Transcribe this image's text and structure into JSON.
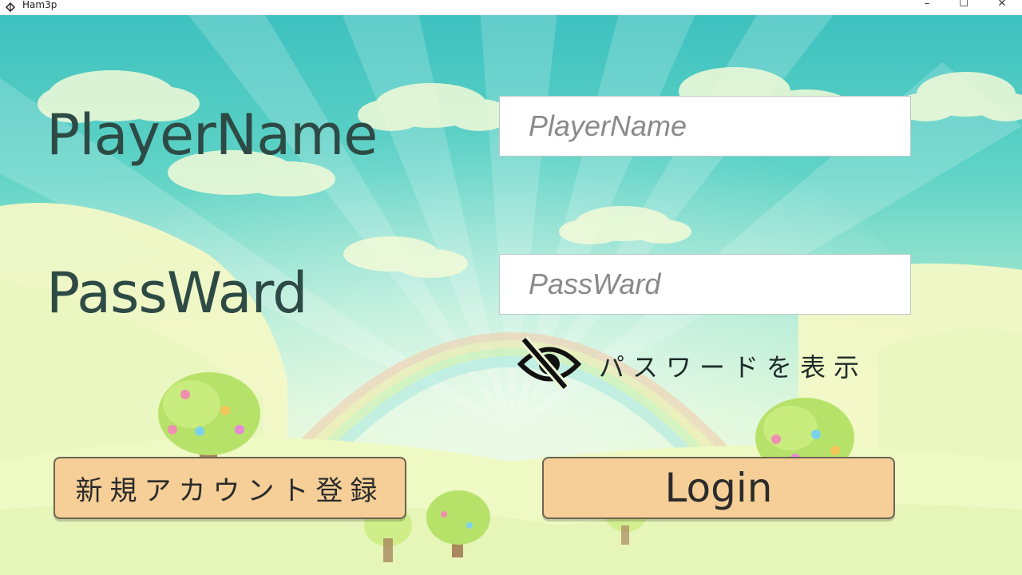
{
  "window": {
    "title": "Ham3p",
    "minimize_glyph": "–",
    "maximize_glyph": "☐",
    "close_glyph": "✕"
  },
  "form": {
    "player_name_label": "PlayerName",
    "player_name_placeholder": "PlayerName",
    "player_name_value": "",
    "password_label": "PassWard",
    "password_placeholder": "PassWard",
    "password_value": "",
    "show_password_label": "パスワードを表示",
    "show_password_icon": "eye-slash-icon"
  },
  "buttons": {
    "register_label": "新規アカウント登録",
    "login_label": "Login"
  },
  "colors": {
    "button_fill": "#f5cf97",
    "label_text": "#2d4a45",
    "sky_top": "#3ec1bf"
  }
}
